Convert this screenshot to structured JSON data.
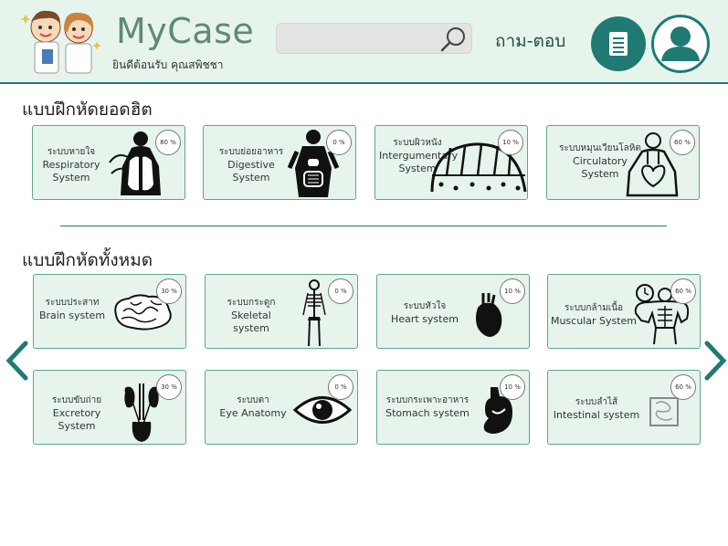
{
  "header": {
    "app_title": "MyCase",
    "welcome_text": "ยินดีต้อนรับ คุณสพิชชา",
    "search_placeholder": "",
    "qa_label": "ถาม-ตอบ"
  },
  "popular": {
    "title": "แบบฝึกหัดยอดฮิต",
    "cards": [
      {
        "th": "ระบบหายใจ",
        "en1": "Respiratory",
        "en2": "System",
        "percent": "80 %"
      },
      {
        "th": "ระบบย่อยอาหาร",
        "en1": "Digestive",
        "en2": "System",
        "percent": "0 %"
      },
      {
        "th": "ระบบผิวหนัง",
        "en1": "Intergumentary",
        "en2": "System",
        "percent": "10 %"
      },
      {
        "th": "ระบบหมุนเวียนโลหิต",
        "en1": "Circulatory",
        "en2": "System",
        "percent": "60 %"
      }
    ]
  },
  "all": {
    "title": "แบบฝึกหัดทั้งหมด",
    "cards": [
      {
        "th": "ระบบประสาท",
        "en": "Brain system",
        "percent": "30 %"
      },
      {
        "th": "ระบบกระดูก",
        "en": "Skeletal system",
        "percent": "0 %"
      },
      {
        "th": "ระบบหัวใจ",
        "en": "Heart system",
        "percent": "10 %"
      },
      {
        "th": "ระบบกล้ามเนื้อ",
        "en": "Muscular System",
        "percent": "60 %"
      },
      {
        "th": "ระบบขับถ่าย",
        "en": "Excretory System",
        "percent": "30 %"
      },
      {
        "th": "ระบบตา",
        "en": "Eye Anatomy",
        "percent": "0 %"
      },
      {
        "th": "ระบบกระเพาะอาหาร",
        "en": "Stomach system",
        "percent": "10 %"
      },
      {
        "th": "ระบบลำไส้",
        "en": "Intestinal system",
        "percent": "60 %"
      }
    ]
  },
  "colors": {
    "accent": "#1f7a73",
    "card_bg": "#e6f4ec",
    "card_border": "#5fa58f"
  },
  "icons": {
    "prev": "chevron-left-icon",
    "next": "chevron-right-icon",
    "search": "search-icon",
    "document": "document-icon",
    "user": "user-icon"
  }
}
